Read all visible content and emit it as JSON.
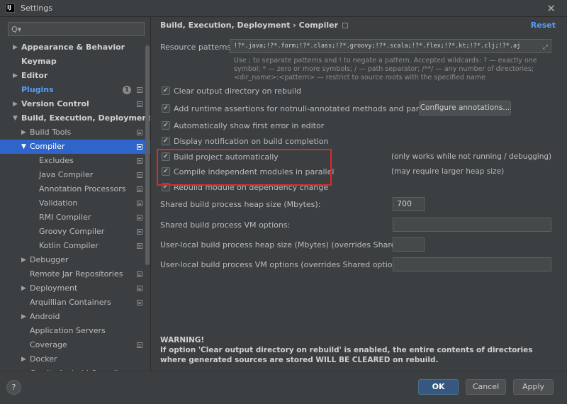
{
  "window": {
    "app_icon_text": "IJ",
    "title": "Settings",
    "close_glyph": "✕"
  },
  "sidebar": {
    "search_placeholder": "Q▾",
    "items": [
      {
        "label": "Appearance & Behavior",
        "level": 0,
        "arrow": "▶",
        "bold": true
      },
      {
        "label": "Keymap",
        "level": 0,
        "arrow": "",
        "bold": true
      },
      {
        "label": "Editor",
        "level": 0,
        "arrow": "▶",
        "bold": true
      },
      {
        "label": "Plugins",
        "level": 0,
        "arrow": "",
        "bold": true,
        "link": true,
        "badge": "1",
        "icon": true
      },
      {
        "label": "Version Control",
        "level": 0,
        "arrow": "▶",
        "bold": true,
        "icon": true
      },
      {
        "label": "Build, Execution, Deployment",
        "level": 0,
        "arrow": "▼",
        "bold": true
      },
      {
        "label": "Build Tools",
        "level": 1,
        "arrow": "▶",
        "icon": true
      },
      {
        "label": "Compiler",
        "level": 1,
        "arrow": "▼",
        "icon": true,
        "selected": true
      },
      {
        "label": "Excludes",
        "level": 2,
        "arrow": "",
        "icon": true
      },
      {
        "label": "Java Compiler",
        "level": 2,
        "arrow": "",
        "icon": true
      },
      {
        "label": "Annotation Processors",
        "level": 2,
        "arrow": "",
        "icon": true
      },
      {
        "label": "Validation",
        "level": 2,
        "arrow": "",
        "icon": true
      },
      {
        "label": "RMI Compiler",
        "level": 2,
        "arrow": "",
        "icon": true
      },
      {
        "label": "Groovy Compiler",
        "level": 2,
        "arrow": "",
        "icon": true
      },
      {
        "label": "Kotlin Compiler",
        "level": 2,
        "arrow": "",
        "icon": true
      },
      {
        "label": "Debugger",
        "level": 1,
        "arrow": "▶"
      },
      {
        "label": "Remote Jar Repositories",
        "level": 1,
        "arrow": "",
        "icon": true
      },
      {
        "label": "Deployment",
        "level": 1,
        "arrow": "▶",
        "icon": true
      },
      {
        "label": "Arquillian Containers",
        "level": 1,
        "arrow": "",
        "icon": true
      },
      {
        "label": "Android",
        "level": 1,
        "arrow": "▶"
      },
      {
        "label": "Application Servers",
        "level": 1,
        "arrow": ""
      },
      {
        "label": "Coverage",
        "level": 1,
        "arrow": "",
        "icon": true
      },
      {
        "label": "Docker",
        "level": 1,
        "arrow": "▶"
      },
      {
        "label": "Gradle-Android Compiler",
        "level": 1,
        "arrow": "",
        "icon": true
      }
    ]
  },
  "main": {
    "breadcrumb": "Build, Execution, Deployment  ›  Compiler",
    "reset_label": "Reset",
    "resource_patterns_label": "Resource patterns:",
    "resource_patterns_value": "!?*.java;!?*.form;!?*.class;!?*.groovy;!?*.scala;!?*.flex;!?*.kt;!?*.clj;!?*.aj",
    "resource_hint": "Use ; to separate patterns and ! to negate a pattern. Accepted wildcards: ? — exactly one symbol; * — zero or more symbols; / — path separator; /**/ — any number of directories; <dir_name>:<pattern> — restrict to source roots with the specified name",
    "checkboxes": [
      {
        "label": "Clear output directory on rebuild",
        "checked": true
      },
      {
        "label": "Add runtime assertions for notnull-annotated methods and parameters",
        "checked": true
      },
      {
        "label": "Automatically show first error in editor",
        "checked": true
      },
      {
        "label": "Display notification on build completion",
        "checked": true
      },
      {
        "label": "Build project automatically",
        "checked": true,
        "note": "(only works while not running / debugging)"
      },
      {
        "label": "Compile independent modules in parallel",
        "checked": true,
        "note": "(may require larger heap size)"
      },
      {
        "label": "Rebuild module on dependency change",
        "checked": true
      }
    ],
    "configure_annotations_label": "Configure annotations...",
    "fields": [
      {
        "label": "Shared build process heap size (Mbytes):",
        "value": "700"
      },
      {
        "label": "Shared build process VM options:",
        "value": ""
      },
      {
        "label": "User-local build process heap size (Mbytes) (overrides Shared size):",
        "value": ""
      },
      {
        "label": "User-local build process VM options (overrides Shared options):",
        "value": ""
      }
    ],
    "warning_title": "WARNING!",
    "warning_text": "If option 'Clear output directory on rebuild' is enabled, the entire contents of directories where generated sources are stored WILL BE CLEARED on rebuild."
  },
  "footer": {
    "help_label": "?",
    "ok_label": "OK",
    "cancel_label": "Cancel",
    "apply_label": "Apply"
  },
  "colors": {
    "background": "#3c3f41",
    "selection": "#2f65ca",
    "link": "#589df6",
    "highlight_box": "#e0282a",
    "ok_button": "#365880"
  }
}
